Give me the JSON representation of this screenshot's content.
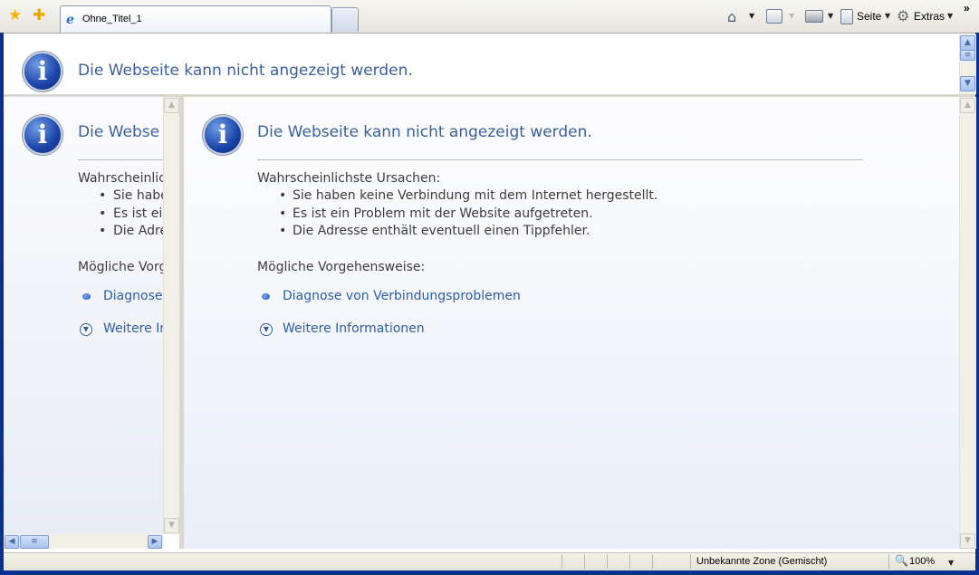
{
  "tab": {
    "title": "Ohne_Titel_1"
  },
  "toolbar": {
    "page_label": "Seite",
    "tools_label": "Extras",
    "more": "»"
  },
  "error": {
    "heading": "Die Webseite kann nicht angezeigt werden.",
    "heading_left": "Die Webse",
    "causes_title": "Wahrscheinlichste Ursachen:",
    "causes_title_left": "Wahrscheinlic",
    "causes": [
      "Sie haben keine Verbindung mit dem Internet hergestellt.",
      "Es ist ein Problem mit der Website aufgetreten.",
      "Die Adresse enthält eventuell einen Tippfehler."
    ],
    "causes_left": [
      "Sie habe",
      "Es ist ei",
      "Die Adre"
    ],
    "actions_title": "Mögliche Vorgehensweise:",
    "actions_title_left": "Mögliche Vorg",
    "link_diagnose": "Diagnose von Verbindungsproblemen",
    "link_diagnose_left": "Diagnose",
    "link_more": "Weitere Informationen",
    "link_more_left": "Weitere In"
  },
  "status": {
    "zone": "Unbekannte Zone (Gemischt)",
    "zoom": "100%"
  },
  "icons": [
    "favorites-star-icon",
    "add-favorites-icon",
    "ie-page-icon",
    "home-icon",
    "feeds-icon",
    "print-icon",
    "page-icon",
    "gear-icon",
    "info-icon",
    "zoom-icon"
  ]
}
